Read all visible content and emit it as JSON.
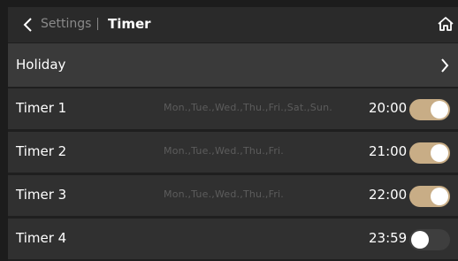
{
  "header": {
    "back_label": "Settings",
    "title": "Timer"
  },
  "holiday": {
    "label": "Holiday"
  },
  "timers": [
    {
      "name": "Timer 1",
      "days": "Mon.,Tue.,Wed.,Thu.,Fri.,Sat.,Sun.",
      "time": "20:00",
      "enabled": true
    },
    {
      "name": "Timer 2",
      "days": "Mon.,Tue.,Wed.,Thu.,Fri.",
      "time": "21:00",
      "enabled": true
    },
    {
      "name": "Timer 3",
      "days": "Mon.,Tue.,Wed.,Thu.,Fri.",
      "time": "22:00",
      "enabled": true
    },
    {
      "name": "Timer 4",
      "days": "",
      "time": "23:59",
      "enabled": false
    }
  ],
  "colors": {
    "toggle_on": "#c8ad86",
    "toggle_off": "#3e3e3e"
  },
  "icons": {
    "back": "chevron-left-icon",
    "home": "home-icon",
    "holiday_arrow": "chevron-right-icon"
  }
}
